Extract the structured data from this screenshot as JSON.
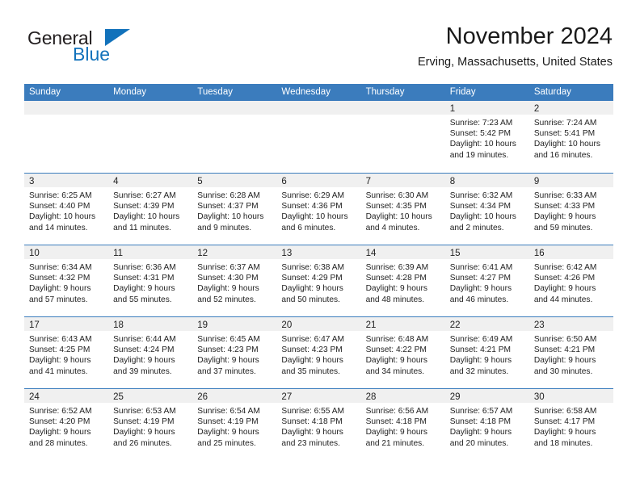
{
  "brand": {
    "line1": "General",
    "line2": "Blue",
    "triangle_color": "#1272bb",
    "text_color": "#231f20"
  },
  "header": {
    "title": "November 2024",
    "subtitle": "Erving, Massachusetts, United States"
  },
  "theme": {
    "header_blue": "#3b7cbd",
    "daynum_band": "#f0f0f0",
    "page_background": "#ffffff",
    "text": "#222222"
  },
  "calendar": {
    "weekday_headers": [
      "Sunday",
      "Monday",
      "Tuesday",
      "Wednesday",
      "Thursday",
      "Friday",
      "Saturday"
    ],
    "weeks": [
      [
        {
          "day": "",
          "lines": []
        },
        {
          "day": "",
          "lines": []
        },
        {
          "day": "",
          "lines": []
        },
        {
          "day": "",
          "lines": []
        },
        {
          "day": "",
          "lines": []
        },
        {
          "day": "1",
          "lines": [
            "Sunrise: 7:23 AM",
            "Sunset: 5:42 PM",
            "Daylight: 10 hours",
            "and 19 minutes."
          ]
        },
        {
          "day": "2",
          "lines": [
            "Sunrise: 7:24 AM",
            "Sunset: 5:41 PM",
            "Daylight: 10 hours",
            "and 16 minutes."
          ]
        }
      ],
      [
        {
          "day": "3",
          "lines": [
            "Sunrise: 6:25 AM",
            "Sunset: 4:40 PM",
            "Daylight: 10 hours",
            "and 14 minutes."
          ]
        },
        {
          "day": "4",
          "lines": [
            "Sunrise: 6:27 AM",
            "Sunset: 4:39 PM",
            "Daylight: 10 hours",
            "and 11 minutes."
          ]
        },
        {
          "day": "5",
          "lines": [
            "Sunrise: 6:28 AM",
            "Sunset: 4:37 PM",
            "Daylight: 10 hours",
            "and 9 minutes."
          ]
        },
        {
          "day": "6",
          "lines": [
            "Sunrise: 6:29 AM",
            "Sunset: 4:36 PM",
            "Daylight: 10 hours",
            "and 6 minutes."
          ]
        },
        {
          "day": "7",
          "lines": [
            "Sunrise: 6:30 AM",
            "Sunset: 4:35 PM",
            "Daylight: 10 hours",
            "and 4 minutes."
          ]
        },
        {
          "day": "8",
          "lines": [
            "Sunrise: 6:32 AM",
            "Sunset: 4:34 PM",
            "Daylight: 10 hours",
            "and 2 minutes."
          ]
        },
        {
          "day": "9",
          "lines": [
            "Sunrise: 6:33 AM",
            "Sunset: 4:33 PM",
            "Daylight: 9 hours",
            "and 59 minutes."
          ]
        }
      ],
      [
        {
          "day": "10",
          "lines": [
            "Sunrise: 6:34 AM",
            "Sunset: 4:32 PM",
            "Daylight: 9 hours",
            "and 57 minutes."
          ]
        },
        {
          "day": "11",
          "lines": [
            "Sunrise: 6:36 AM",
            "Sunset: 4:31 PM",
            "Daylight: 9 hours",
            "and 55 minutes."
          ]
        },
        {
          "day": "12",
          "lines": [
            "Sunrise: 6:37 AM",
            "Sunset: 4:30 PM",
            "Daylight: 9 hours",
            "and 52 minutes."
          ]
        },
        {
          "day": "13",
          "lines": [
            "Sunrise: 6:38 AM",
            "Sunset: 4:29 PM",
            "Daylight: 9 hours",
            "and 50 minutes."
          ]
        },
        {
          "day": "14",
          "lines": [
            "Sunrise: 6:39 AM",
            "Sunset: 4:28 PM",
            "Daylight: 9 hours",
            "and 48 minutes."
          ]
        },
        {
          "day": "15",
          "lines": [
            "Sunrise: 6:41 AM",
            "Sunset: 4:27 PM",
            "Daylight: 9 hours",
            "and 46 minutes."
          ]
        },
        {
          "day": "16",
          "lines": [
            "Sunrise: 6:42 AM",
            "Sunset: 4:26 PM",
            "Daylight: 9 hours",
            "and 44 minutes."
          ]
        }
      ],
      [
        {
          "day": "17",
          "lines": [
            "Sunrise: 6:43 AM",
            "Sunset: 4:25 PM",
            "Daylight: 9 hours",
            "and 41 minutes."
          ]
        },
        {
          "day": "18",
          "lines": [
            "Sunrise: 6:44 AM",
            "Sunset: 4:24 PM",
            "Daylight: 9 hours",
            "and 39 minutes."
          ]
        },
        {
          "day": "19",
          "lines": [
            "Sunrise: 6:45 AM",
            "Sunset: 4:23 PM",
            "Daylight: 9 hours",
            "and 37 minutes."
          ]
        },
        {
          "day": "20",
          "lines": [
            "Sunrise: 6:47 AM",
            "Sunset: 4:23 PM",
            "Daylight: 9 hours",
            "and 35 minutes."
          ]
        },
        {
          "day": "21",
          "lines": [
            "Sunrise: 6:48 AM",
            "Sunset: 4:22 PM",
            "Daylight: 9 hours",
            "and 34 minutes."
          ]
        },
        {
          "day": "22",
          "lines": [
            "Sunrise: 6:49 AM",
            "Sunset: 4:21 PM",
            "Daylight: 9 hours",
            "and 32 minutes."
          ]
        },
        {
          "day": "23",
          "lines": [
            "Sunrise: 6:50 AM",
            "Sunset: 4:21 PM",
            "Daylight: 9 hours",
            "and 30 minutes."
          ]
        }
      ],
      [
        {
          "day": "24",
          "lines": [
            "Sunrise: 6:52 AM",
            "Sunset: 4:20 PM",
            "Daylight: 9 hours",
            "and 28 minutes."
          ]
        },
        {
          "day": "25",
          "lines": [
            "Sunrise: 6:53 AM",
            "Sunset: 4:19 PM",
            "Daylight: 9 hours",
            "and 26 minutes."
          ]
        },
        {
          "day": "26",
          "lines": [
            "Sunrise: 6:54 AM",
            "Sunset: 4:19 PM",
            "Daylight: 9 hours",
            "and 25 minutes."
          ]
        },
        {
          "day": "27",
          "lines": [
            "Sunrise: 6:55 AM",
            "Sunset: 4:18 PM",
            "Daylight: 9 hours",
            "and 23 minutes."
          ]
        },
        {
          "day": "28",
          "lines": [
            "Sunrise: 6:56 AM",
            "Sunset: 4:18 PM",
            "Daylight: 9 hours",
            "and 21 minutes."
          ]
        },
        {
          "day": "29",
          "lines": [
            "Sunrise: 6:57 AM",
            "Sunset: 4:18 PM",
            "Daylight: 9 hours",
            "and 20 minutes."
          ]
        },
        {
          "day": "30",
          "lines": [
            "Sunrise: 6:58 AM",
            "Sunset: 4:17 PM",
            "Daylight: 9 hours",
            "and 18 minutes."
          ]
        }
      ]
    ]
  }
}
